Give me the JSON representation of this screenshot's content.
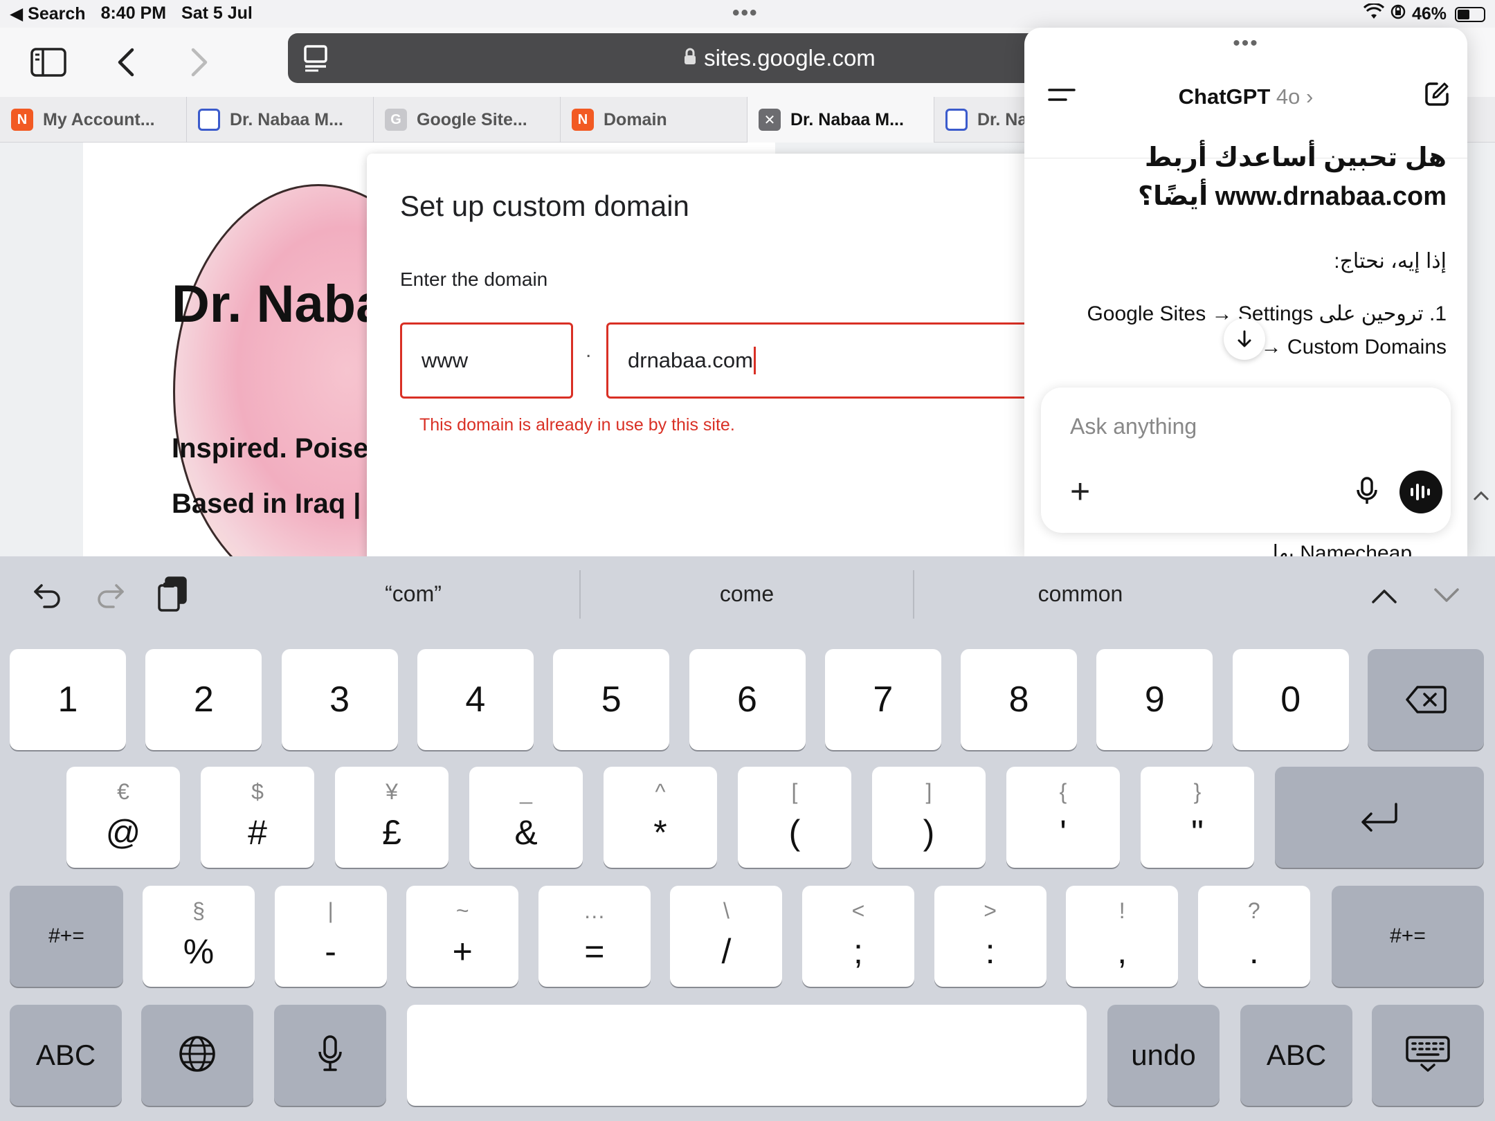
{
  "status_bar": {
    "back_app": "◀ Search",
    "time": "8:40 PM",
    "date": "Sat 5 Jul",
    "dots": "•••",
    "battery": "46%",
    "battery_level": 0.46
  },
  "browser": {
    "url": "sites.google.com",
    "tabs": [
      {
        "label": "My Account...",
        "favicon": "N",
        "favicon_style": "orange"
      },
      {
        "label": "Dr. Nabaa M...",
        "favicon": "",
        "favicon_style": "blue"
      },
      {
        "label": "Google Site...",
        "favicon": "G",
        "favicon_style": "gray"
      },
      {
        "label": "Domain",
        "favicon": "N",
        "favicon_style": "orange"
      },
      {
        "label": "Dr. Nabaa M...",
        "favicon": "✕",
        "favicon_style": "x",
        "active": true
      },
      {
        "label": "Dr. Na",
        "favicon": "",
        "favicon_style": "blue"
      }
    ]
  },
  "site": {
    "heading": "Dr. Naba",
    "tagline": "Inspired. Poise",
    "location": "Based in Iraq | "
  },
  "dialog": {
    "title": "Set up custom domain",
    "label": "Enter the domain",
    "subdomain_value": "www",
    "separator": ".",
    "domain_value": "drnabaa.com",
    "error": "This domain is already in use by this site."
  },
  "chat": {
    "grab": "•••",
    "title": "ChatGPT",
    "model": "4o",
    "chevron": "›",
    "message_question": "هل تحبين أساعدك أربط www.drnabaa.com أيضًا؟",
    "message_line": "إذا إيه، نحتاج:",
    "message_step": "1. تروحين على Google Sites → Settings → Custom Domains",
    "peek_text": "Namecheap بها.",
    "input_placeholder": "Ask anything",
    "plus": "+"
  },
  "keyboard": {
    "suggestions": [
      "“com”",
      "come",
      "common"
    ],
    "row1": [
      "1",
      "2",
      "3",
      "4",
      "5",
      "6",
      "7",
      "8",
      "9",
      "0"
    ],
    "row2": [
      {
        "main": "@",
        "sub": "€"
      },
      {
        "main": "#",
        "sub": "$"
      },
      {
        "main": "£",
        "sub": "¥"
      },
      {
        "main": "&",
        "sub": "_"
      },
      {
        "main": "*",
        "sub": "^"
      },
      {
        "main": "(",
        "sub": "["
      },
      {
        "main": ")",
        "sub": "]"
      },
      {
        "main": "'",
        "sub": "{"
      },
      {
        "main": "\"",
        "sub": "}"
      }
    ],
    "row3": [
      {
        "main": "%",
        "sub": "§"
      },
      {
        "main": "-",
        "sub": "|"
      },
      {
        "main": "+",
        "sub": "~"
      },
      {
        "main": "=",
        "sub": "…"
      },
      {
        "main": "/",
        "sub": "\\"
      },
      {
        "main": ";",
        "sub": "<"
      },
      {
        "main": ":",
        "sub": ">"
      },
      {
        "main": ",",
        "sub": "!"
      },
      {
        "main": ".",
        "sub": "?"
      }
    ],
    "shift_left": "#+=",
    "shift_right": "#+=",
    "abc_left": "ABC",
    "undo": "undo",
    "abc_right": "ABC"
  }
}
